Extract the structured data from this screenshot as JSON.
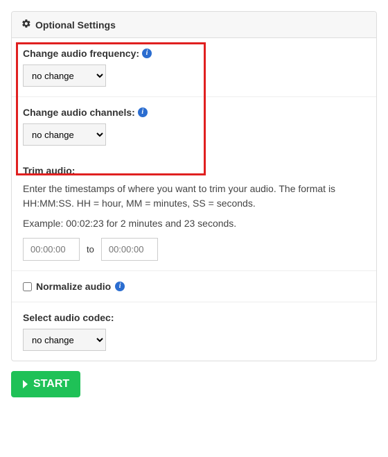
{
  "header": {
    "title": "Optional Settings"
  },
  "frequency": {
    "label": "Change audio frequency:",
    "value": "no change"
  },
  "channels": {
    "label": "Change audio channels:",
    "value": "no change"
  },
  "trim": {
    "label": "Trim audio:",
    "description": "Enter the timestamps of where you want to trim your audio. The format is HH:MM:SS. HH = hour, MM = minutes, SS = seconds.",
    "example": "Example: 00:02:23 for 2 minutes and 23 seconds.",
    "start_placeholder": "00:00:00",
    "to_label": "to",
    "end_placeholder": "00:00:00"
  },
  "normalize": {
    "label": "Normalize audio"
  },
  "codec": {
    "label": "Select audio codec:",
    "value": "no change"
  },
  "start_button": {
    "label": "START"
  }
}
